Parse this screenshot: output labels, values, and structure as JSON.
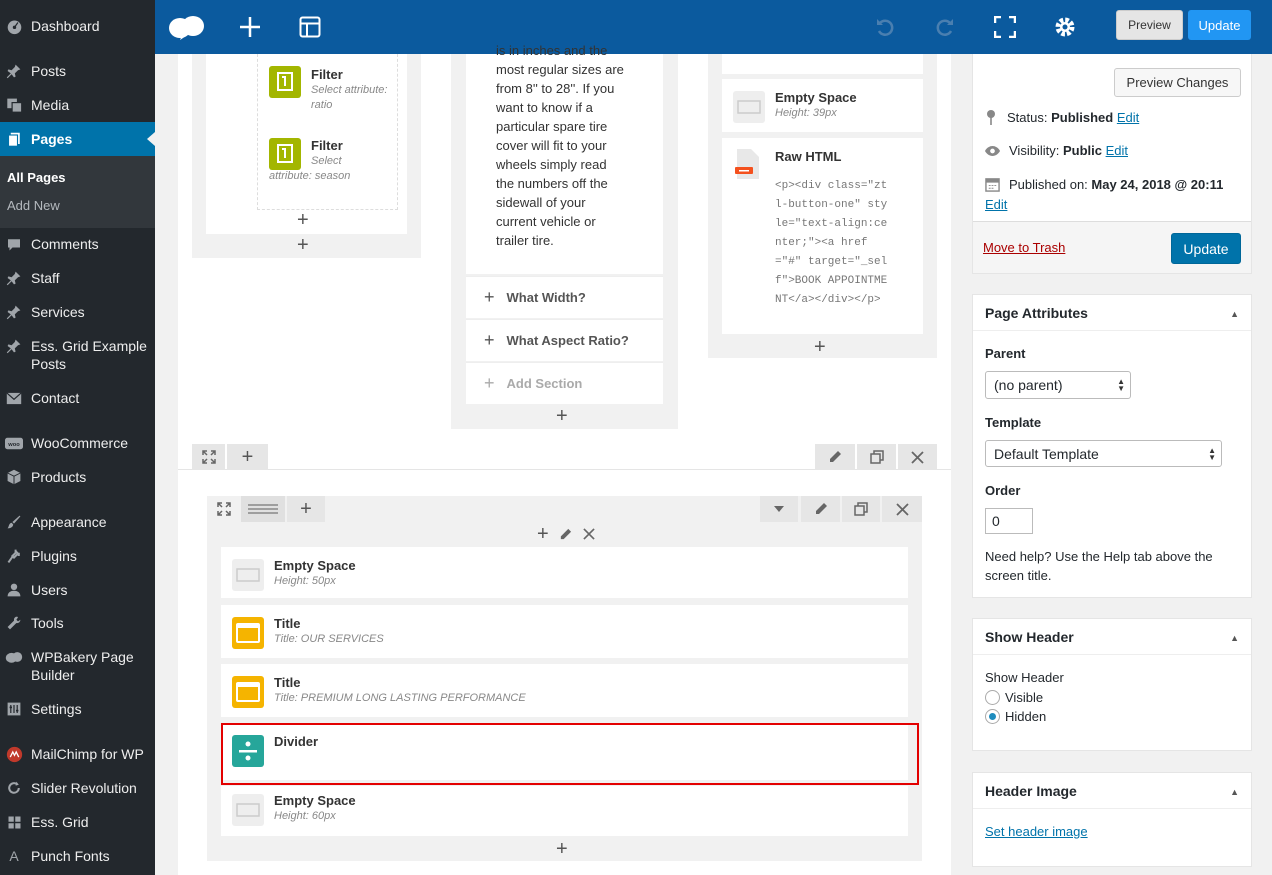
{
  "sidebar": {
    "items": [
      {
        "label": "Dashboard",
        "icon": "dashboard-icon"
      },
      {
        "label": "Posts",
        "icon": "pin-icon"
      },
      {
        "label": "Media",
        "icon": "media-icon"
      },
      {
        "label": "Pages",
        "icon": "pages-icon"
      },
      {
        "label": "Comments",
        "icon": "comment-icon"
      },
      {
        "label": "Staff",
        "icon": "pin-icon"
      },
      {
        "label": "Services",
        "icon": "pin-icon"
      },
      {
        "label": "Ess. Grid Example Posts",
        "icon": "pin-icon"
      },
      {
        "label": "Contact",
        "icon": "mail-icon"
      },
      {
        "label": "WooCommerce",
        "icon": "woo-icon"
      },
      {
        "label": "Products",
        "icon": "box-icon"
      },
      {
        "label": "Appearance",
        "icon": "brush-icon"
      },
      {
        "label": "Plugins",
        "icon": "plug-icon"
      },
      {
        "label": "Users",
        "icon": "user-icon"
      },
      {
        "label": "Tools",
        "icon": "wrench-icon"
      },
      {
        "label": "WPBakery Page Builder",
        "icon": "cloud-icon"
      },
      {
        "label": "Settings",
        "icon": "settings-icon"
      },
      {
        "label": "MailChimp for WP",
        "icon": "mailchimp-icon"
      },
      {
        "label": "Slider Revolution",
        "icon": "refresh-icon"
      },
      {
        "label": "Ess. Grid",
        "icon": "grid-icon"
      },
      {
        "label": "Punch Fonts",
        "icon": "font-icon"
      }
    ],
    "submenu": [
      "All Pages",
      "Add New"
    ]
  },
  "toolbar": {
    "preview_label": "Preview",
    "update_label": "Update"
  },
  "editor": {
    "filters": [
      {
        "title": "Filter",
        "sub": "Select attribute: ratio"
      },
      {
        "title": "Filter",
        "sub": "Select attribute: season"
      }
    ],
    "text_block": {
      "lines": [
        "is in inches and the",
        "most regular sizes are",
        "from 8'' to 28''. If you",
        "want to know if a",
        "particular spare tire",
        "cover will fit to your",
        "wheels simply read",
        "the numbers off the",
        "sidewall of your",
        "current vehicle or",
        "trailer tire."
      ]
    },
    "accordion": [
      "What Width?",
      "What Aspect Ratio?",
      "Add Section"
    ],
    "right_col": {
      "empty_space": {
        "title": "Empty Space",
        "sub": "Height: 39px"
      },
      "raw_html": {
        "title": "Raw HTML",
        "code": [
          "<p><div class=\"zt",
          "l-button-one\" sty",
          "le=\"text-align:ce",
          "nter;\"><a href",
          "=\"#\" target=\"_sel",
          "f\">BOOK APPOINTME",
          "NT</a></div></p>"
        ]
      }
    },
    "rows": [
      {
        "title": "Empty Space",
        "sub": "Height: 50px",
        "kind": "empty"
      },
      {
        "title": "Title",
        "sub": "Title: OUR SERVICES",
        "kind": "title"
      },
      {
        "title": "Title",
        "sub": "Title: PREMIUM LONG LASTING PERFORMANCE",
        "kind": "title"
      },
      {
        "title": "Divider",
        "sub": "",
        "kind": "divider"
      },
      {
        "title": "Empty Space",
        "sub": "Height: 60px",
        "kind": "empty"
      }
    ]
  },
  "publish": {
    "preview_changes": "Preview Changes",
    "status_label": "Status:",
    "status_value": "Published",
    "visibility_label": "Visibility:",
    "visibility_value": "Public",
    "published_label": "Published on:",
    "published_value": "May 24, 2018 @ 20:11",
    "edit": "Edit",
    "trash": "Move to Trash",
    "update": "Update"
  },
  "page_attributes": {
    "heading": "Page Attributes",
    "parent_label": "Parent",
    "parent_value": "(no parent)",
    "template_label": "Template",
    "template_value": "Default Template",
    "order_label": "Order",
    "order_value": "0",
    "help": [
      "Need help? Use the Help tab above the",
      "screen title."
    ]
  },
  "show_header": {
    "heading": "Show Header",
    "label": "Show Header",
    "options": [
      "Visible",
      "Hidden"
    ],
    "selected": "Hidden"
  },
  "header_image": {
    "heading": "Header Image",
    "link": "Set header image"
  },
  "colors": {
    "sidebar_bg": "#23282d",
    "toolbar_bg": "#0b5a9e",
    "wp_blue": "#0073aa",
    "title_icon": "#f5b400",
    "filter_icon": "#a3b600",
    "divider_icon": "#26a69a",
    "highlight": "#e30000"
  }
}
